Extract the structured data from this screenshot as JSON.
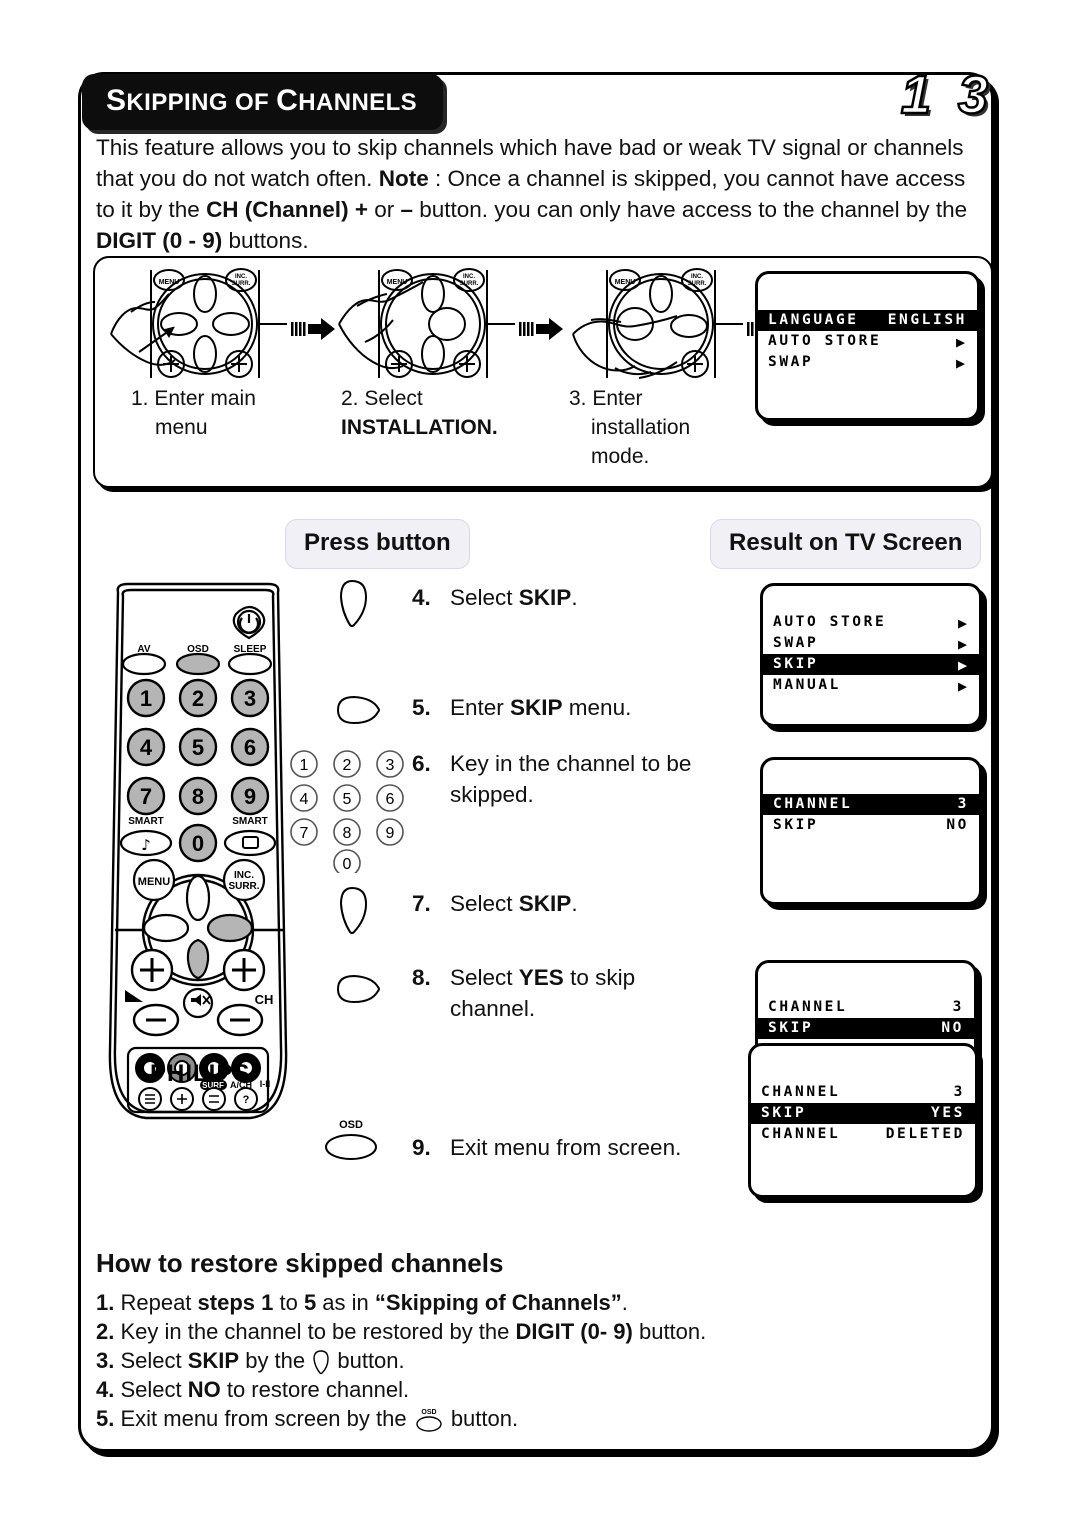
{
  "page": {
    "title_first_letter": "S",
    "title_rest_1": "KIPPING OF ",
    "title_c": "C",
    "title_rest_2": "HANNELS",
    "number": "1 3"
  },
  "intro": {
    "part1": "This feature allows you to skip channels which have bad or weak TV signal or channels that you do not watch often. ",
    "note_label": "Note",
    "part2": " : Once a channel is skipped, you cannot have access to it by the ",
    "ch_label": "CH (Channel)",
    "part3": " ",
    "plus": "+",
    "part4": " or ",
    "minus": "–",
    "part5": " button. you can only have access to the channel by the ",
    "digit_label": "DIGIT (0 - 9)",
    "part6": " buttons."
  },
  "steps_top": [
    {
      "num": "1.",
      "line1": "Enter main",
      "line2": "menu",
      "bold2": ""
    },
    {
      "num": "2.",
      "line1": "Select",
      "line2": "",
      "bold2": "INSTALLATION."
    },
    {
      "num": "3.",
      "line1": "Enter",
      "line2": "installation",
      "line3": "mode.",
      "bold2": ""
    }
  ],
  "columns": {
    "press_button": "Press button",
    "result_on_tv": "Result on TV Screen"
  },
  "steps": [
    {
      "num": "4.",
      "pre": "Select ",
      "bold": "SKIP",
      "post": ".",
      "icon": "cursor-down-button"
    },
    {
      "num": "5.",
      "pre": "Enter ",
      "bold": "SKIP",
      "post": " menu.",
      "icon": "cursor-right-button"
    },
    {
      "num": "6.",
      "pre": "Key in the channel to be",
      "bold": "",
      "post": "",
      "line2": "skipped.",
      "icon": "digit-keypad"
    },
    {
      "num": "7.",
      "pre": "Select ",
      "bold": "SKIP",
      "post": ".",
      "icon": "cursor-down-button"
    },
    {
      "num": "8.",
      "pre": "Select ",
      "bold": "YES",
      "post": " to skip",
      "line2": "channel.",
      "icon": "cursor-right-button"
    },
    {
      "num": "9.",
      "pre": "Exit menu from screen.",
      "bold": "",
      "post": "",
      "icon": "osd-button",
      "icon_label": "OSD"
    }
  ],
  "keypad": [
    "1",
    "2",
    "3",
    "4",
    "5",
    "6",
    "7",
    "8",
    "9",
    "0"
  ],
  "tv_screens": {
    "installation_menu": [
      {
        "label": "LANGUAGE",
        "value": "ENGLISH",
        "arrow": false,
        "highlight": true
      },
      {
        "label": "AUTO STORE",
        "value": "",
        "arrow": true,
        "highlight": false
      },
      {
        "label": "SWAP",
        "value": "",
        "arrow": true,
        "highlight": false
      }
    ],
    "skip_menu": [
      {
        "label": "AUTO STORE",
        "value": "",
        "arrow": true,
        "highlight": false
      },
      {
        "label": "SWAP",
        "value": "",
        "arrow": true,
        "highlight": false
      },
      {
        "label": "SKIP",
        "value": "",
        "arrow": true,
        "highlight": true
      },
      {
        "label": "MANUAL",
        "value": "",
        "arrow": true,
        "highlight": false
      }
    ],
    "channel_menu": [
      {
        "label": "CHANNEL",
        "value": "3",
        "arrow": false,
        "highlight": true
      },
      {
        "label": "SKIP",
        "value": "NO",
        "arrow": false,
        "highlight": false
      }
    ],
    "skip_no_menu": [
      {
        "label": "CHANNEL",
        "value": "3",
        "arrow": false,
        "highlight": false
      },
      {
        "label": "SKIP",
        "value": "NO",
        "arrow": false,
        "highlight": true
      }
    ],
    "skip_yes_menu": [
      {
        "label": "CHANNEL",
        "value": "3",
        "arrow": false,
        "highlight": false
      },
      {
        "label": "SKIP",
        "value": "YES",
        "arrow": false,
        "highlight": true
      },
      {
        "label": "CHANNEL",
        "value": "DELETED",
        "arrow": false,
        "highlight": false
      }
    ]
  },
  "remote": {
    "brand": "PHILIPS",
    "av": "AV",
    "osd": "OSD",
    "sleep": "SLEEP",
    "smart_left": "SMART",
    "smart_right": "SMART",
    "menu": "MENU",
    "inc_surr_1": "INC.",
    "inc_surr_2": "SURR.",
    "ch": "CH",
    "surf": "SURF",
    "ach": "A/CH",
    "iii": "I-II",
    "digits": [
      "1",
      "2",
      "3",
      "4",
      "5",
      "6",
      "7",
      "8",
      "9",
      "0"
    ]
  },
  "restore": {
    "heading": "How to restore skipped channels",
    "items": [
      {
        "num": "1.",
        "a": " Repeat ",
        "b1": "steps 1",
        "c": " to ",
        "b2": "5",
        "d": " as in ",
        "b3": "“Skipping of Channels”",
        "e": "."
      },
      {
        "num": "2.",
        "a": " Key in the channel to be restored by the ",
        "b1": "DIGIT (0- 9)",
        "c": " button.",
        "b2": "",
        "d": "",
        "b3": "",
        "e": ""
      },
      {
        "num": "3.",
        "a": " Select ",
        "b1": "SKIP",
        "c": " by the ",
        "b2": "",
        "d": " button.",
        "b3": "",
        "e": ""
      },
      {
        "num": "4.",
        "a": " Select ",
        "b1": "NO",
        "c": " to restore channel.",
        "b2": "",
        "d": "",
        "b3": "",
        "e": ""
      },
      {
        "num": "5.",
        "a": " Exit menu from screen by the ",
        "b1": "",
        "c": "",
        "b2": "",
        "d": " button.",
        "b3": "",
        "e": ""
      }
    ]
  },
  "colors": {
    "header_pill_bg": "#0d0d0d",
    "col_head_bg": "#f1f0f7",
    "ink": "#000000",
    "button_gray": "#b5b5b5"
  }
}
